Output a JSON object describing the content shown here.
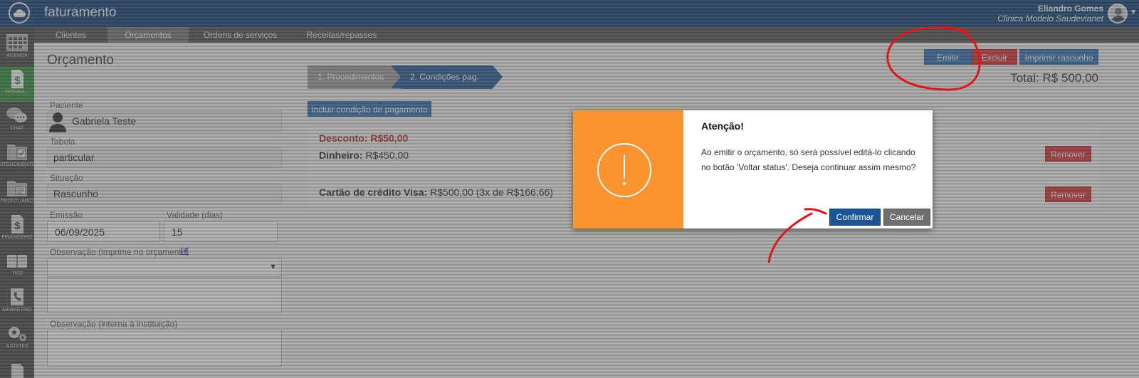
{
  "header": {
    "app_title": "faturamento",
    "user_name": "Eliandro Gomes",
    "user_clinic": "Clinica Modelo Saudevianet"
  },
  "sidebar": {
    "items": [
      {
        "label": "AGENDA",
        "icon": "calendar-grid-icon"
      },
      {
        "label": "FATURA...",
        "icon": "dollar-document-icon",
        "active": true
      },
      {
        "label": "CHAT",
        "icon": "chat-bubbles-icon"
      },
      {
        "label": "ATENDIMENTO",
        "icon": "folder-check-icon"
      },
      {
        "label": "PRONTUÁRIO",
        "icon": "folder-document-icon"
      },
      {
        "label": "FINANCEIRO",
        "icon": "dollar-document-icon"
      },
      {
        "label": "TISS",
        "icon": "book-icon"
      },
      {
        "label": "MARKETING",
        "icon": "phone-document-icon"
      },
      {
        "label": "AJUSTES",
        "icon": "gears-icon"
      }
    ]
  },
  "subnav": {
    "tabs": [
      "Clientes",
      "Orçamentos",
      "Ordens de serviços",
      "Receitas/repasses"
    ],
    "active": "Orçamentos"
  },
  "page": {
    "title": "Orçamento",
    "actions": {
      "emitir": "Emitir",
      "excluir": "Excluir",
      "imprimir": "Imprimir rascunho"
    },
    "total": "Total: R$ 500,00",
    "steps": [
      "1. Procedimentos",
      "2. Condições pag."
    ],
    "add_payment_label": "Incluir condição de pagamento"
  },
  "form": {
    "paciente_label": "Paciente",
    "paciente_value": "Gabriela Teste",
    "tabela_label": "Tabela",
    "tabela_value": "particular",
    "situacao_label": "Situação",
    "situacao_value": "Rascunho",
    "emissao_label": "Emissão",
    "emissao_value": "06/09/2025",
    "validade_label": "Validade (dias)",
    "validade_value": "15",
    "obs_label": "Observação (imprime no orçamento)",
    "obs_interna_label": "Observação (interna à instituição)"
  },
  "payments": {
    "discount": "Desconto: R$50,00",
    "cash_label": "Dinheiro:",
    "cash_value": "R$450,00",
    "card_label": "Cartão de crédito Visa:",
    "card_value": "R$500,00 (3x de R$166,66)",
    "remove_label": "Remover"
  },
  "modal": {
    "title": "Atenção!",
    "message": "Ao emitir o orçamento, só será possível editá-lo clicando no botão 'Voltar status'. Deseja continuar assim mesmo?",
    "confirm": "Confirmar",
    "cancel": "Cancelar",
    "icon": "exclamation-icon",
    "accent_color": "#f99431"
  },
  "colors": {
    "header": "#0a3a73",
    "primary": "#2a6db5",
    "danger": "#d9292c",
    "annotation": "#e0161b"
  }
}
